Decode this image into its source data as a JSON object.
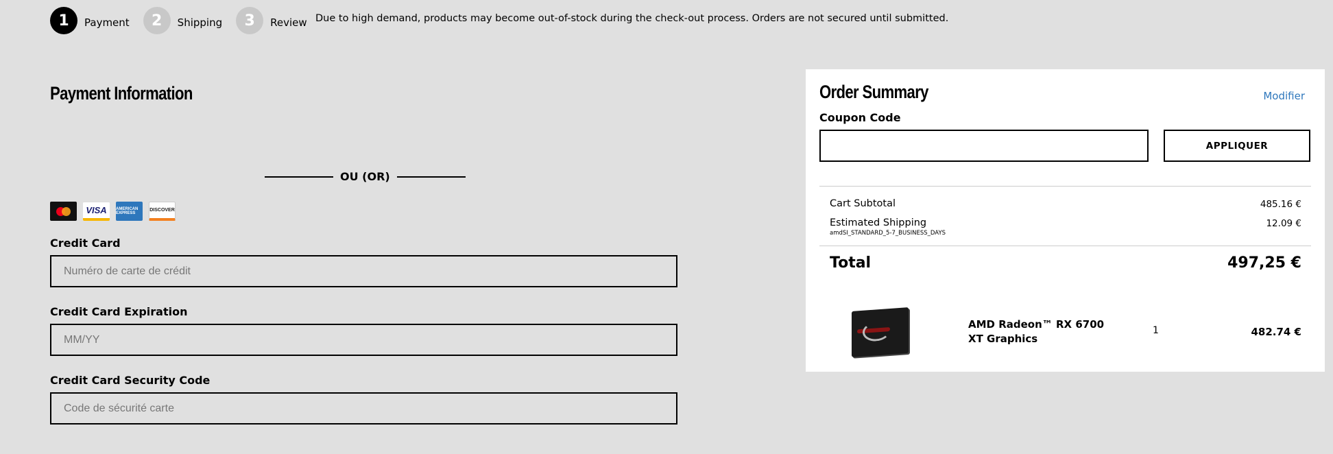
{
  "steps": [
    {
      "number": "1",
      "label": "Payment"
    },
    {
      "number": "2",
      "label": "Shipping"
    },
    {
      "number": "3",
      "label": "Review"
    }
  ],
  "notice": "Due to high demand, products may become out-of-stock during the check-out process. Orders are not secured until submitted.",
  "payment": {
    "title": "Payment Information",
    "divider_text": "OU (OR)",
    "card_logos": [
      {
        "name": "mastercard-icon"
      },
      {
        "name": "visa-icon",
        "text": "VISA"
      },
      {
        "name": "amex-icon",
        "text": "AMERICAN EXPRESS"
      },
      {
        "name": "discover-icon",
        "text": "DISCOVER"
      }
    ],
    "credit_card_label": "Credit Card",
    "credit_card_placeholder": "Numéro de carte de crédit",
    "expiration_label": "Credit Card Expiration",
    "expiration_placeholder": "MM/YY",
    "security_label": "Credit Card Security Code",
    "security_placeholder": "Code de sécurité carte"
  },
  "summary": {
    "title": "Order Summary",
    "modify_link": "Modifier",
    "coupon_label": "Coupon Code",
    "coupon_value": "",
    "apply_button": "APPLIQUER",
    "subtotal_label": "Cart Subtotal",
    "subtotal_value": "485.16 €",
    "shipping_label": "Estimated Shipping",
    "shipping_value": "12.09 €",
    "shipping_code": "amdSI_STANDARD_5-7_BUSINESS_DAYS",
    "total_label": "Total",
    "total_value": "497,25 €",
    "product": {
      "name": "AMD Radeon™ RX 6700 XT Graphics",
      "quantity": "1",
      "price": "482.74 €"
    }
  }
}
